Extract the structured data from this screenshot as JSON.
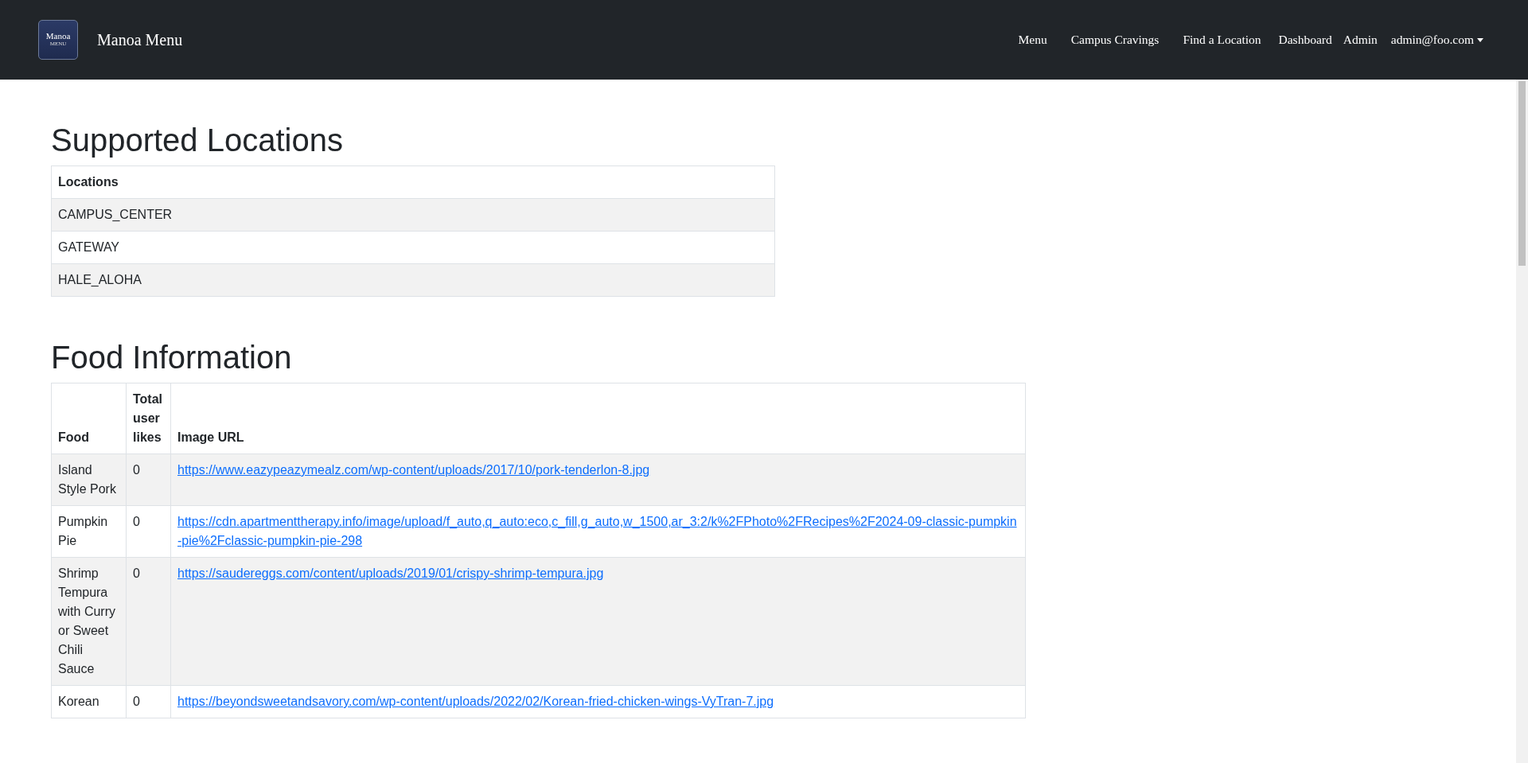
{
  "navbar": {
    "logo_text": "Manoa",
    "logo_subtext": "MENU",
    "brand": "Manoa Menu",
    "links": [
      "Menu",
      "Campus Cravings",
      "Find a Location",
      "Dashboard",
      "Admin"
    ],
    "user_menu": "admin@foo.com"
  },
  "locations": {
    "title": "Supported Locations",
    "columns": [
      "Locations"
    ],
    "rows": [
      "CAMPUS_CENTER",
      "GATEWAY",
      "HALE_ALOHA"
    ]
  },
  "foods": {
    "title": "Food Information",
    "columns": [
      "Food",
      "Total user likes",
      "Image URL"
    ],
    "rows": [
      {
        "food": "Island Style Pork",
        "likes": "0",
        "url": "https://www.eazypeazymealz.com/wp-content/uploads/2017/10/pork-tenderlon-8.jpg"
      },
      {
        "food": "Pumpkin Pie",
        "likes": "0",
        "url": "https://cdn.apartmenttherapy.info/image/upload/f_auto,q_auto:eco,c_fill,g_auto,w_1500,ar_3:2/k%2FPhoto%2FRecipes%2F2024-09-classic-pumpkin-pie%2Fclassic-pumpkin-pie-298"
      },
      {
        "food": "Shrimp Tempura with Curry or Sweet Chili Sauce",
        "likes": "0",
        "url": "https://saudereggs.com/content/uploads/2019/01/crispy-shrimp-tempura.jpg"
      },
      {
        "food": "Korean",
        "likes": "0",
        "url": "https://beyondsweetandsavory.com/wp-content/uploads/2022/02/Korean-fried-chicken-wings-VyTran-7.jpg"
      }
    ]
  }
}
